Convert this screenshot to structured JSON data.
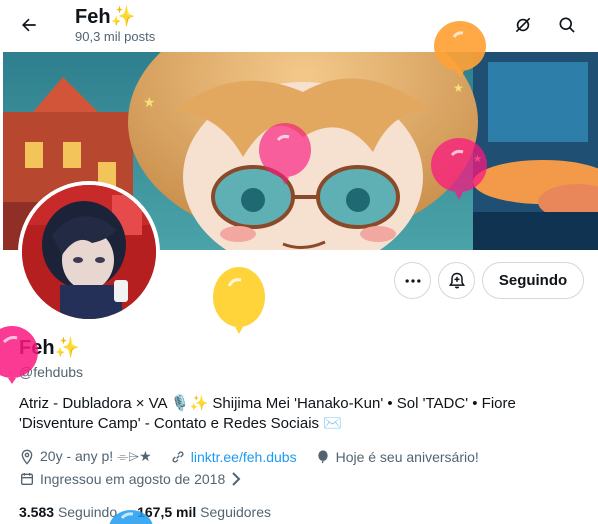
{
  "header": {
    "title": "Feh",
    "title_emoji": "✨",
    "post_count": "90,3 mil posts"
  },
  "icons": {
    "back": "arrow-left-icon",
    "top_right_1": "no-notifications-icon",
    "top_right_2": "search-icon"
  },
  "actions": {
    "more_label": "more-options-icon",
    "notify_label": "bell-add-icon",
    "follow_label": "Seguindo"
  },
  "profile": {
    "name": "Feh",
    "name_emoji": "✨",
    "handle": "@fehdubs",
    "bio_line1": "Atriz - Dubladora × VA 🎙️✨ Shijima Mei 'Hanako-Kun' • Sol 'TADC' • Fiore",
    "bio_line2": "'Disventure Camp' - Contato e Redes Sociais ✉️",
    "location": "20y - any p! ⌯⌲★",
    "link": "linktr.ee/feh.dubs",
    "birthday": "Hoje é seu aniversário!",
    "joined": "Ingressou em agosto de 2018",
    "following_count": "3.583",
    "following_label": "Seguindo",
    "followers_count": "167,5 mil",
    "followers_label": "Seguidores"
  },
  "colors": {
    "accent": "#1d9bf0",
    "balloon_orange": "#ffa236",
    "balloon_pink": "#f91880",
    "balloon_yellow": "#ffd43b",
    "balloon_blue": "#1d9bf0"
  }
}
